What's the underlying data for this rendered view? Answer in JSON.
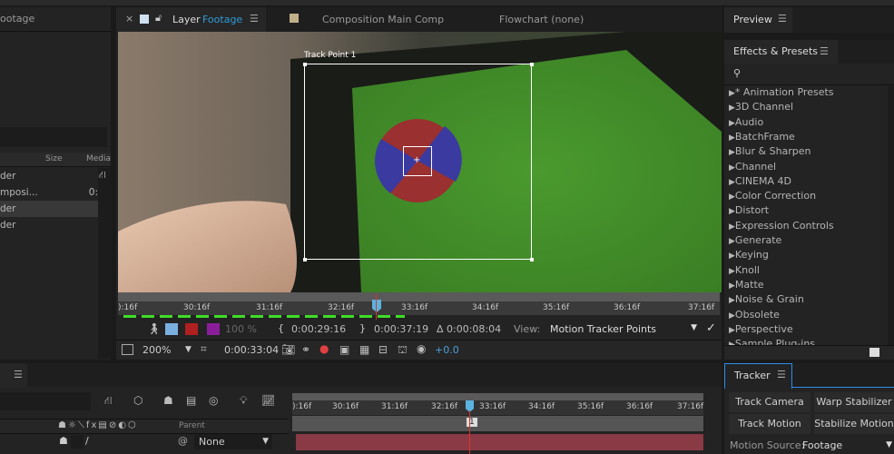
{
  "project": {
    "tab": "ootage",
    "columns": {
      "size": "Size",
      "media": "Media"
    },
    "rows": [
      {
        "name": "der",
        "value": ""
      },
      {
        "name": "mposi...",
        "value": "0:"
      },
      {
        "name": "der",
        "value": ""
      },
      {
        "name": "der",
        "value": ""
      }
    ]
  },
  "viewer": {
    "tabs": [
      {
        "close": "×",
        "label": "Layer",
        "sub": "Footage"
      },
      {
        "label": "Composition",
        "sub": "Main Comp"
      },
      {
        "label": "Flowchart",
        "sub": "(none)"
      }
    ],
    "track_point": "Track Point 1",
    "ruler": [
      "):16f",
      "30:16f",
      "31:16f",
      "32:16f",
      "33:16f",
      "34:16f",
      "35:16f",
      "36:16f",
      "37:16f"
    ],
    "controls": {
      "opacity": "100 %",
      "in_time": "0:00:29:16",
      "out_time": "0:00:37:19",
      "duration": "Δ 0:00:08:04",
      "view_label": "View:",
      "view_value": "Motion Tracker Points"
    },
    "bottom": {
      "zoom": "200%",
      "timecode": "0:00:33:04",
      "exposure": "+0.0"
    }
  },
  "preview": {
    "tab": "Preview"
  },
  "effects": {
    "tab": "Effects & Presets",
    "items": [
      "* Animation Presets",
      "3D Channel",
      "Audio",
      "BatchFrame",
      "Blur & Sharpen",
      "Channel",
      "CINEMA 4D",
      "Color Correction",
      "Distort",
      "Expression Controls",
      "Generate",
      "Keying",
      "Knoll",
      "Matte",
      "Noise & Grain",
      "Obsolete",
      "Perspective",
      "Sample Plug-ins"
    ]
  },
  "timeline": {
    "parent_header": "Parent",
    "parent_value": "None",
    "ruler": [
      "):16f",
      "30:16f",
      "31:16f",
      "32:16f",
      "33:16f",
      "34:16f",
      "35:16f",
      "36:16f",
      "37:16f"
    ],
    "keyframe": "1"
  },
  "tracker": {
    "tab": "Tracker",
    "buttons": [
      "Track Camera",
      "Warp Stabilizer",
      "Track Motion",
      "Stabilize Motion"
    ],
    "motion_source_label": "Motion Source:",
    "motion_source_value": "Footage"
  },
  "colors": {
    "accent": "#2d8ceb",
    "playhead": "#5ab4e0",
    "footage_label": "#2e9cd8",
    "exposure": "#4a9fd8"
  }
}
